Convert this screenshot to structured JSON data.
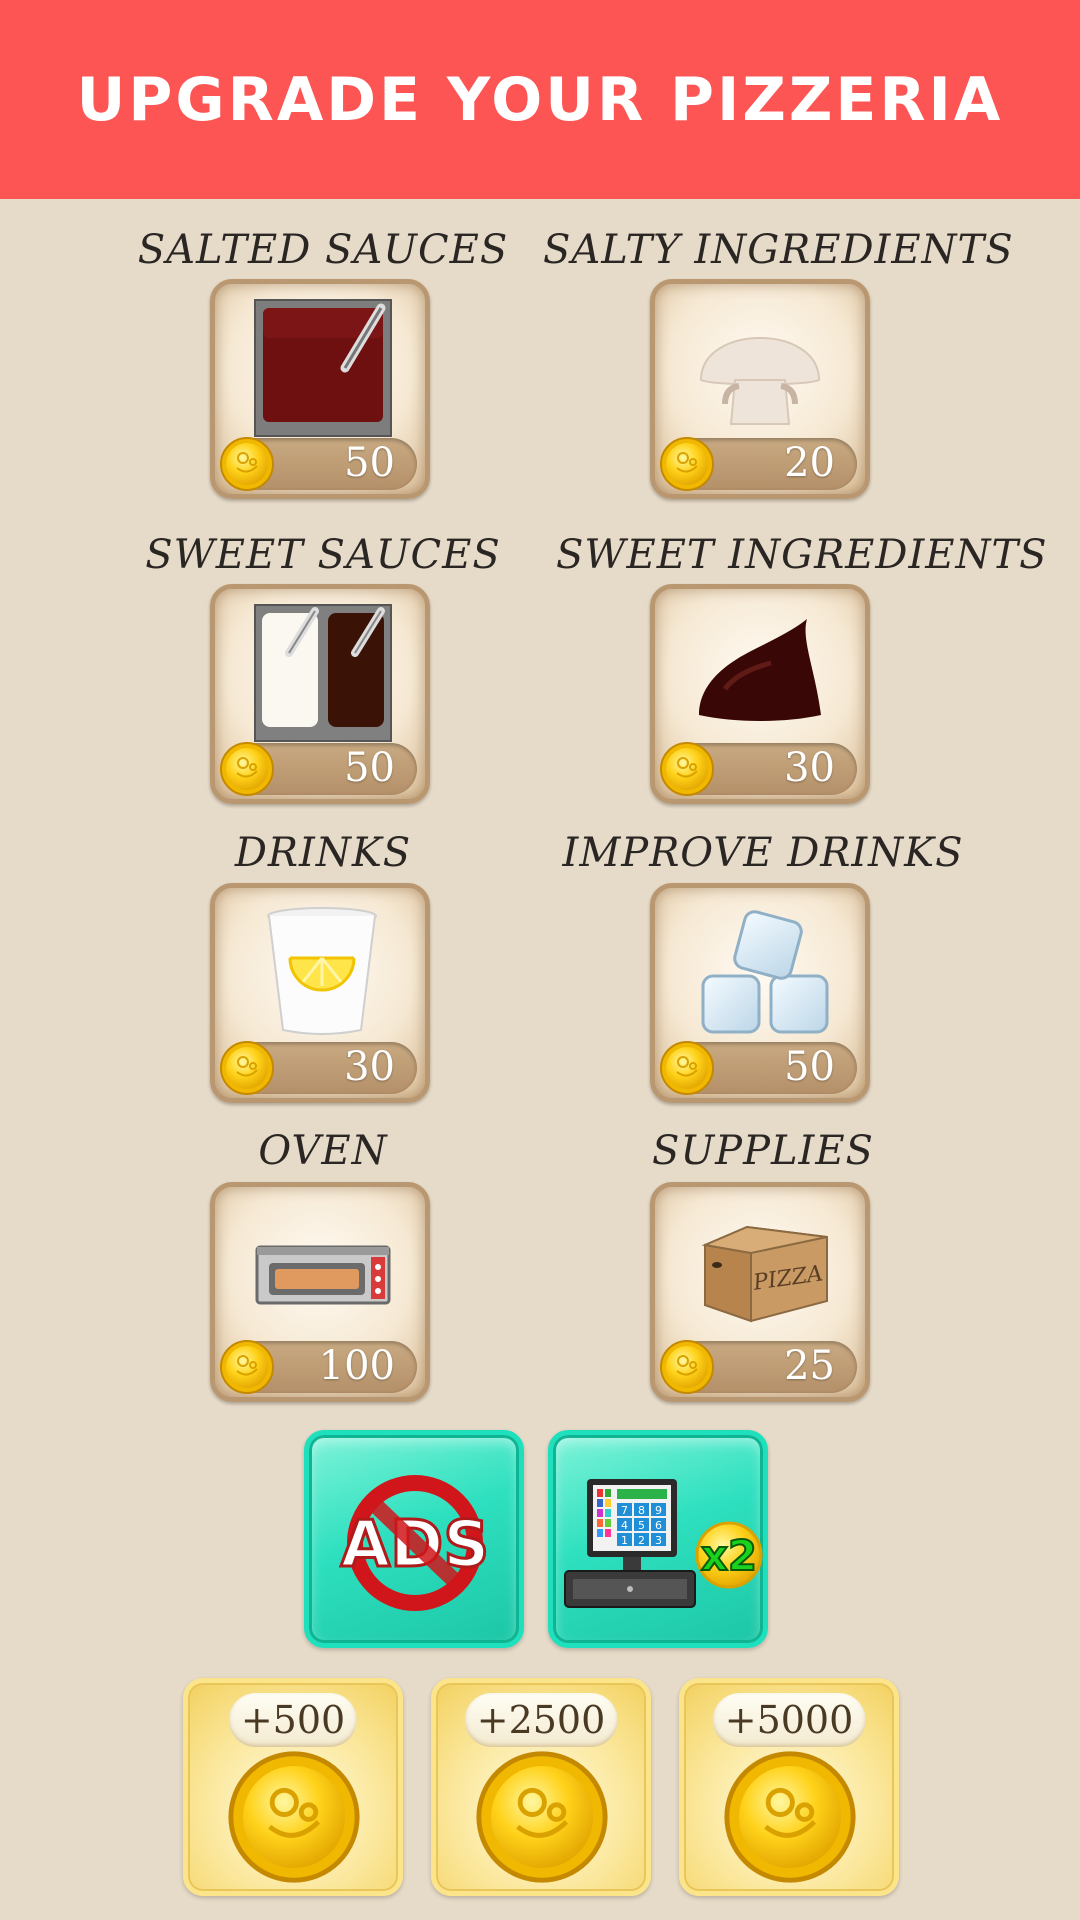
{
  "header": {
    "title": "UPGRADE YOUR PIZZERIA"
  },
  "upgrades": [
    {
      "label": "SALTED SAUCES",
      "price": "50",
      "icon": "salted-sauce-tray-icon"
    },
    {
      "label": "SALTY INGREDIENTS",
      "price": "20",
      "icon": "mushroom-icon"
    },
    {
      "label": "SWEET SAUCES",
      "price": "50",
      "icon": "sweet-sauce-trays-icon"
    },
    {
      "label": "SWEET INGREDIENTS",
      "price": "30",
      "icon": "chocolate-drop-icon"
    },
    {
      "label": "DRINKS",
      "price": "30",
      "icon": "lemonade-cup-icon"
    },
    {
      "label": "IMPROVE DRINKS",
      "price": "50",
      "icon": "ice-cubes-icon"
    },
    {
      "label": "OVEN",
      "price": "100",
      "icon": "oven-icon"
    },
    {
      "label": "SUPPLIES",
      "price": "25",
      "icon": "pizza-box-icon"
    }
  ],
  "specials": {
    "remove_ads": {
      "text": "ADS",
      "icon": "no-ads-icon"
    },
    "double_register": {
      "text": "x2",
      "icon": "cash-register-icon"
    }
  },
  "coin_packs": [
    {
      "amount": "+500"
    },
    {
      "amount": "+2500"
    },
    {
      "amount": "+5000"
    }
  ],
  "register_keys": [
    "7",
    "8",
    "9",
    "4",
    "5",
    "6",
    "1",
    "2",
    "3"
  ],
  "box_text": "PIZZA",
  "colors": {
    "header": "#fd5554",
    "background": "#e6dac8",
    "teal": "#2ee0bf",
    "gold": "#f3d160"
  }
}
